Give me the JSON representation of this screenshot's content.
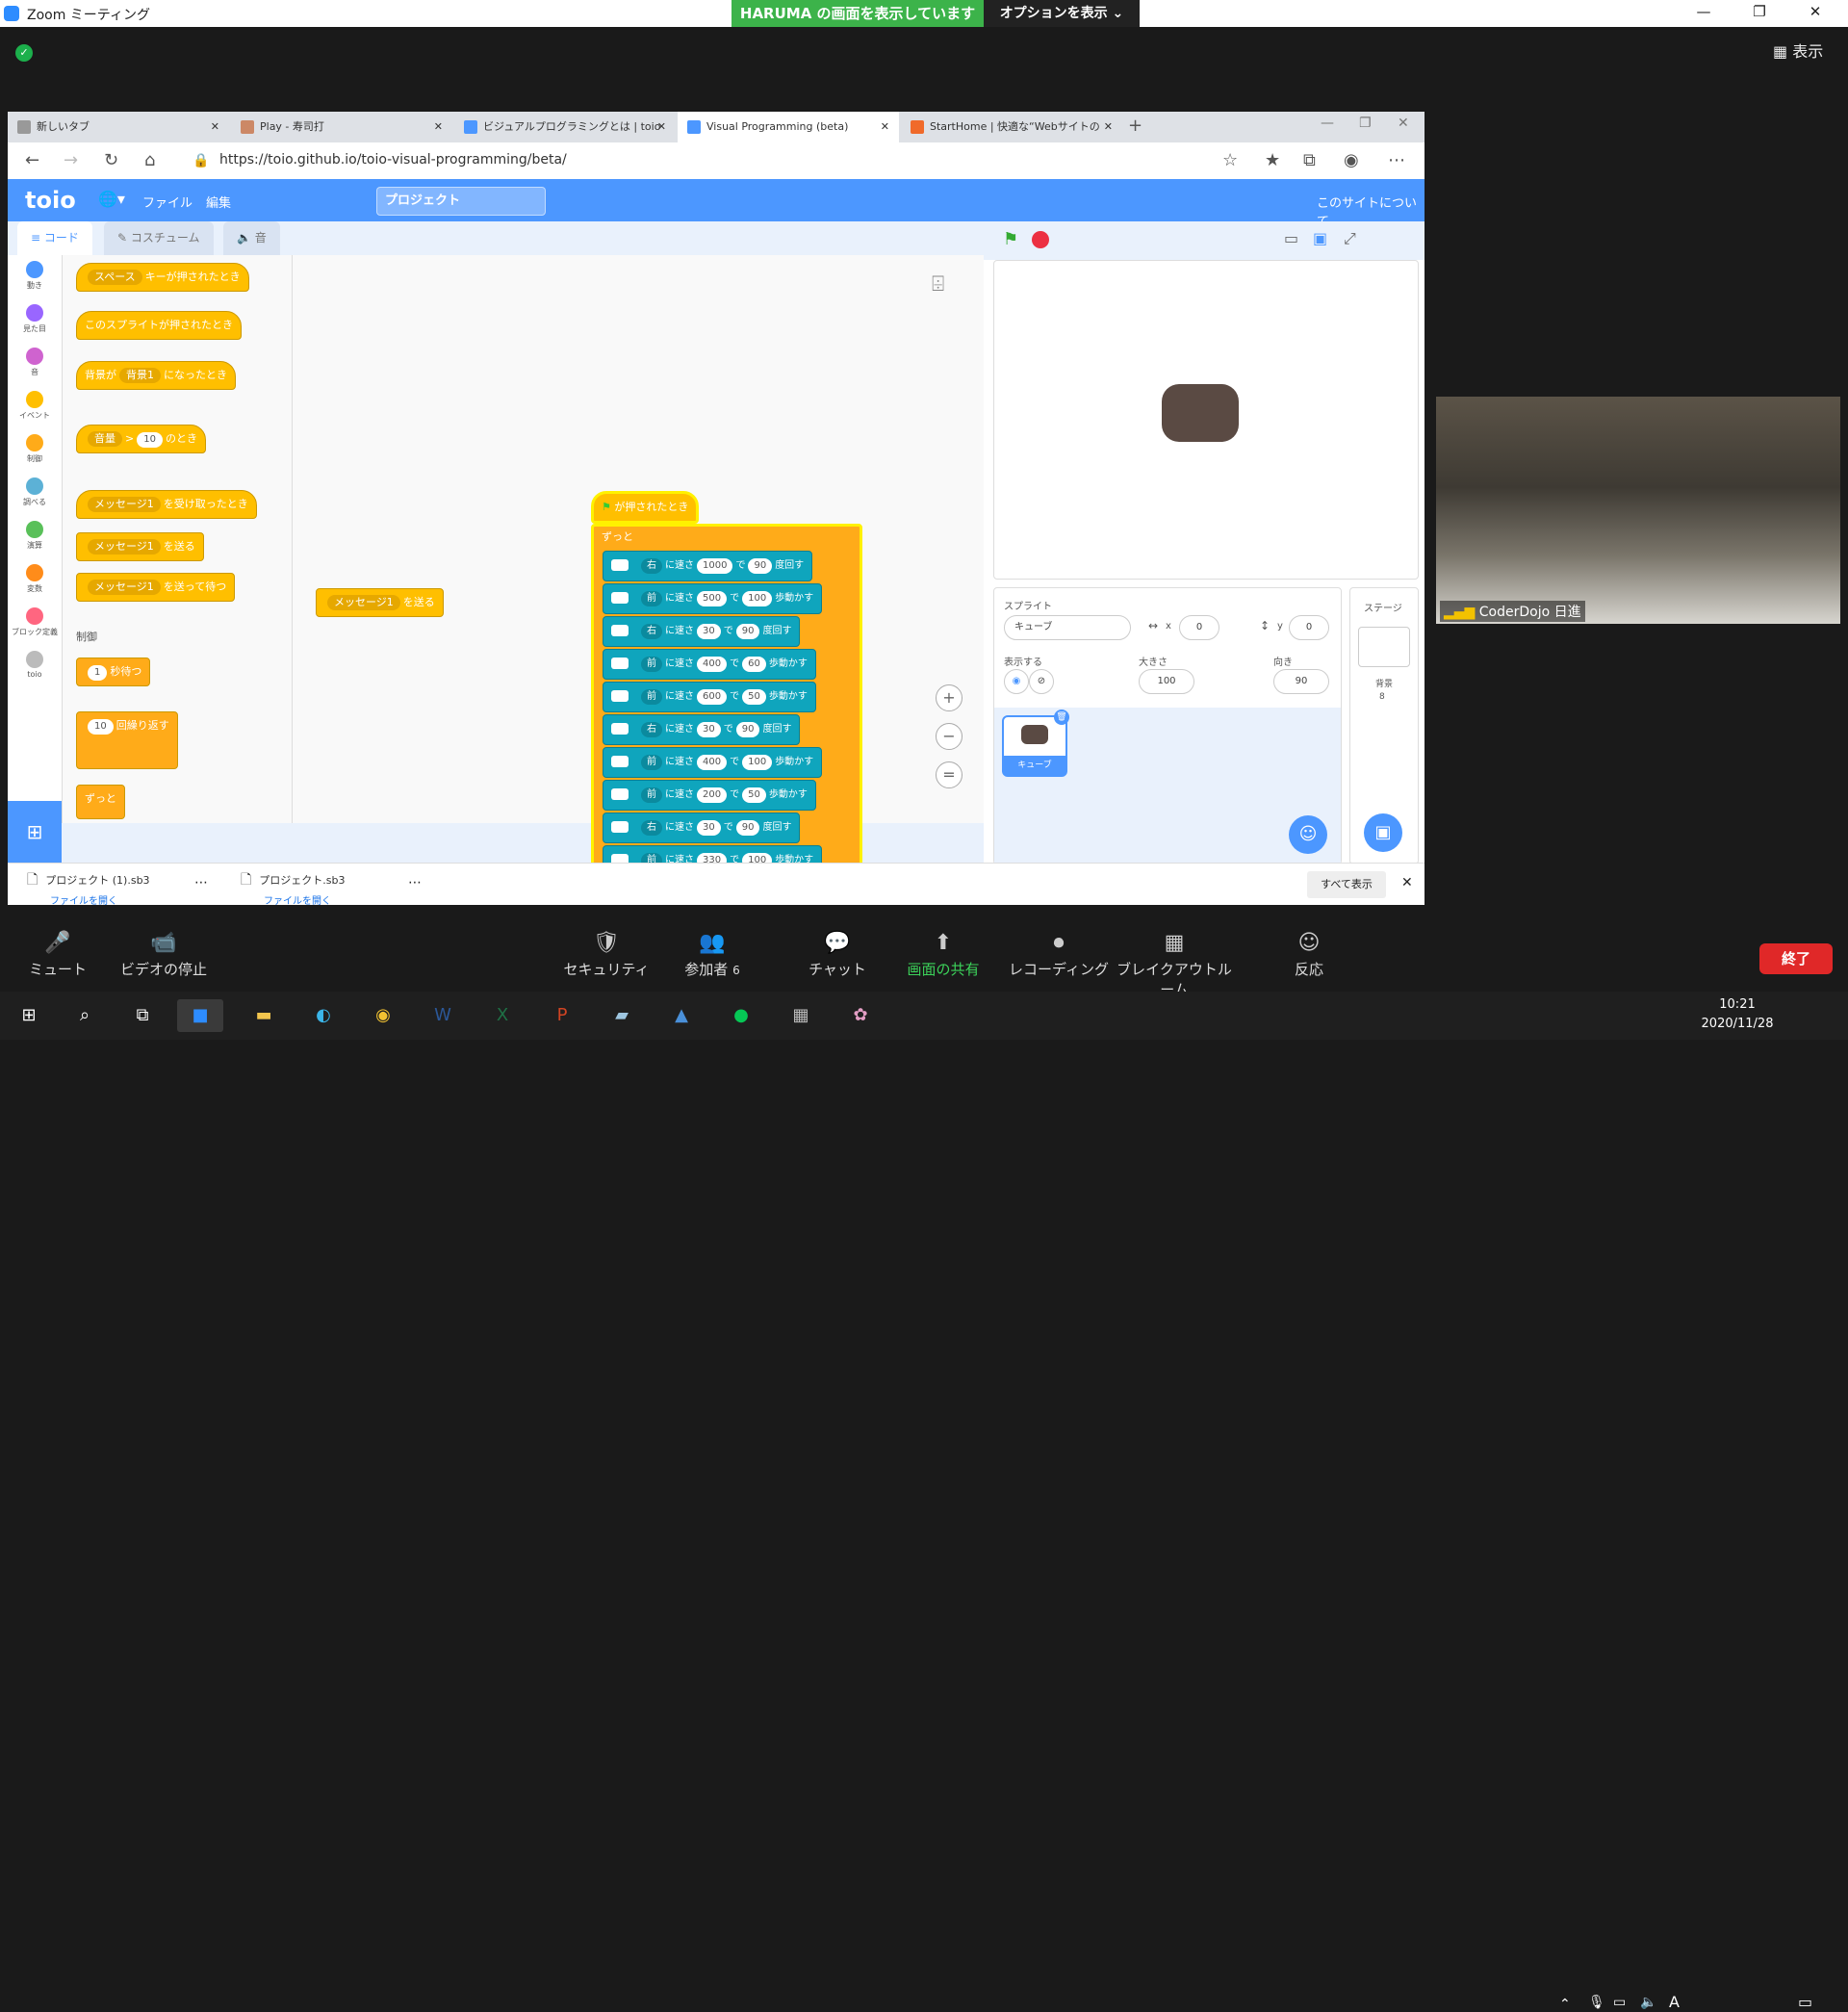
{
  "zoom": {
    "window_title": "Zoom ミーティング",
    "share_banner": "HARUMA の画面を表示しています",
    "options_banner": "オプションを表示 ⌄",
    "view_label": "表示",
    "participant_name": "CoderDojo 日進",
    "toolbar": [
      {
        "name": "mute",
        "label": "ミュート",
        "icon": "🎤"
      },
      {
        "name": "video-stop",
        "label": "ビデオの停止",
        "icon": "📹"
      },
      {
        "name": "security",
        "label": "セキュリティ",
        "icon": "🛡"
      },
      {
        "name": "participants",
        "label": "参加者",
        "icon": "👥",
        "count": "6"
      },
      {
        "name": "chat",
        "label": "チャット",
        "icon": "💬"
      },
      {
        "name": "share-screen",
        "label": "画面の共有",
        "icon": "⬆"
      },
      {
        "name": "recording",
        "label": "レコーディング",
        "icon": "⏺"
      },
      {
        "name": "breakout",
        "label": "ブレイクアウトルーム",
        "icon": "▦"
      },
      {
        "name": "reaction",
        "label": "反応",
        "icon": "☺"
      }
    ],
    "end_label": "終了"
  },
  "browser": {
    "tabs": [
      "新しいタブ",
      "Play - 寿司打",
      "ビジュアルプログラミングとは | toio",
      "Visual Programming (beta)",
      "StartHome | 快適な“Webサイトの"
    ],
    "url": "https://toio.github.io/toio-visual-programming/beta/",
    "downloads": [
      {
        "file": "プロジェクト (1).sb3",
        "action": "ファイルを開く"
      },
      {
        "file": "プロジェクト.sb3",
        "action": "ファイルを開く"
      }
    ],
    "show_all": "すべて表示"
  },
  "scratch": {
    "logo": "toio",
    "menu_file": "ファイル",
    "menu_edit": "編集",
    "project_name": "プロジェクト",
    "about": "このサイトについて",
    "tab_code": "コード",
    "tab_costume": "コスチューム",
    "tab_sound": "音",
    "categories": [
      {
        "label": "動き",
        "color": "#4c97ff"
      },
      {
        "label": "見た目",
        "color": "#9966ff"
      },
      {
        "label": "音",
        "color": "#cf63cf"
      },
      {
        "label": "イベント",
        "color": "#ffbf00"
      },
      {
        "label": "制御",
        "color": "#ffab19"
      },
      {
        "label": "調べる",
        "color": "#5cb1d6"
      },
      {
        "label": "演算",
        "color": "#59c059"
      },
      {
        "label": "変数",
        "color": "#ff8c1a"
      },
      {
        "label": "ブロック定義",
        "color": "#ff6680"
      },
      {
        "label": "toio",
        "color": "#bbbbbb"
      }
    ],
    "palette": {
      "key_pressed": {
        "key": "スペース",
        "text": "キーが押されたとき"
      },
      "sprite_clicked": "このスプライトが押されたとき",
      "backdrop_switch": {
        "prefix": "背景が",
        "value": "背景1",
        "suffix": "になったとき"
      },
      "when_greater": {
        "value": "音量",
        "op": ">",
        "num": "10",
        "suffix": "のとき"
      },
      "receive": {
        "value": "メッセージ1",
        "suffix": "を受け取ったとき"
      },
      "broadcast": {
        "value": "メッセージ1",
        "suffix": "を送る"
      },
      "broadcast_wait": {
        "value": "メッセージ1",
        "suffix": "を送って待つ"
      },
      "control_header": "制御",
      "wait": {
        "num": "1",
        "suffix": "秒待つ"
      },
      "repeat": {
        "num": "10",
        "suffix": "回繰り返す"
      },
      "forever": "ずっと"
    },
    "workspace": {
      "loose_broadcast": {
        "value": "メッセージ1",
        "suffix": "を送る"
      },
      "script_hat": "が押されたとき",
      "forever": "ずっと",
      "moves": [
        {
          "dir": "右",
          "speed": "1000",
          "amount": "90",
          "verb": "度回す"
        },
        {
          "dir": "前",
          "speed": "500",
          "amount": "100",
          "verb": "歩動かす"
        },
        {
          "dir": "右",
          "speed": "30",
          "amount": "90",
          "verb": "度回す"
        },
        {
          "dir": "前",
          "speed": "400",
          "amount": "60",
          "verb": "歩動かす"
        },
        {
          "dir": "前",
          "speed": "600",
          "amount": "50",
          "verb": "歩動かす"
        },
        {
          "dir": "右",
          "speed": "30",
          "amount": "90",
          "verb": "度回す"
        },
        {
          "dir": "前",
          "speed": "400",
          "amount": "100",
          "verb": "歩動かす"
        },
        {
          "dir": "前",
          "speed": "200",
          "amount": "50",
          "verb": "歩動かす"
        },
        {
          "dir": "右",
          "speed": "30",
          "amount": "90",
          "verb": "度回す"
        },
        {
          "dir": "前",
          "speed": "330",
          "amount": "100",
          "verb": "歩動かす"
        }
      ],
      "speed_word": "に速さ",
      "de": "で"
    },
    "sprite_panel": {
      "label_sprite": "スプライト",
      "sprite_name": "キューブ",
      "x_label": "x",
      "x": "0",
      "y_label": "y",
      "y": "0",
      "show_label": "表示する",
      "size_label": "大きさ",
      "size": "100",
      "direction_label": "向き",
      "direction": "90",
      "thumb_name": "キューブ",
      "stage_label": "ステージ",
      "backdrops_label": "背景",
      "backdrops_count": "8"
    }
  },
  "taskbar": {
    "time": "10:21",
    "date": "2020/11/28",
    "ime": "A"
  }
}
